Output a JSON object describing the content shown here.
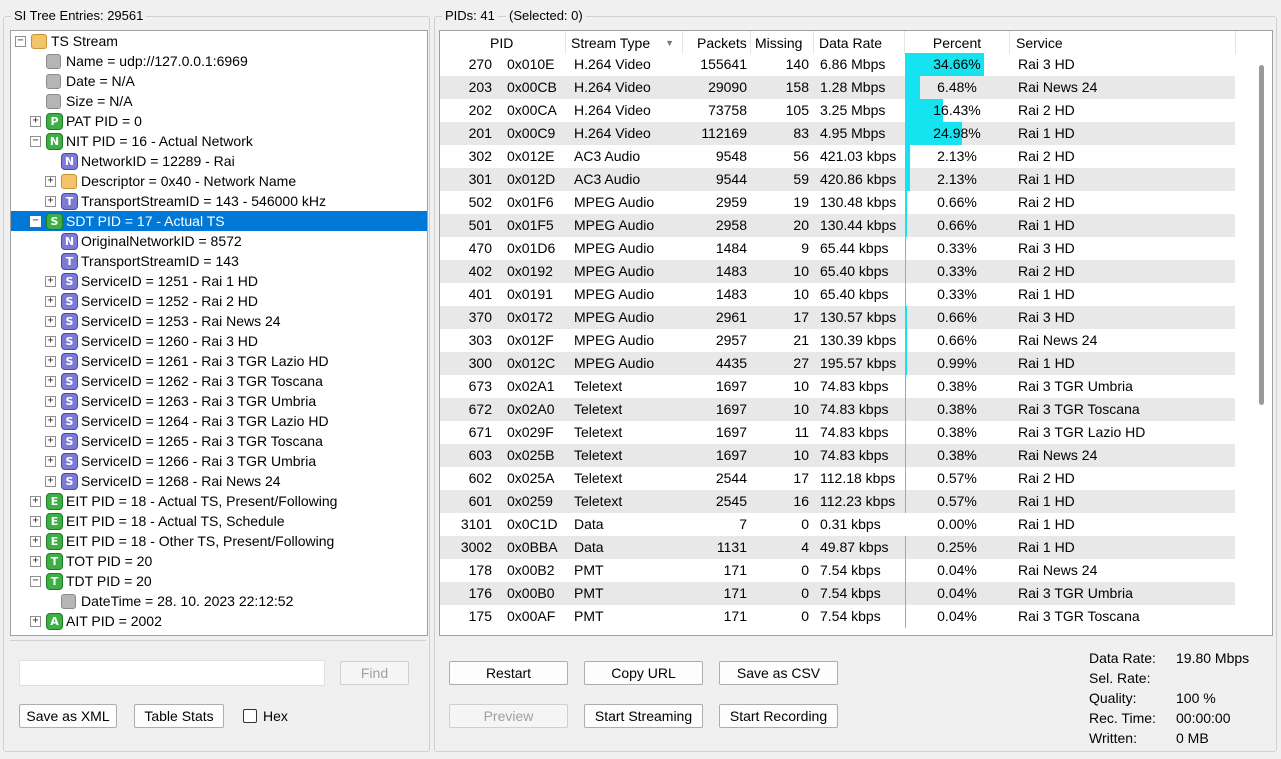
{
  "left_panel": {
    "title": "SI Tree Entries: 29561",
    "find_placeholder": "",
    "find_label": "Find",
    "save_xml_label": "Save as XML",
    "table_stats_label": "Table Stats",
    "hex_label": "Hex"
  },
  "tree": [
    {
      "depth": 0,
      "exp": "-",
      "icon": "folder",
      "letter": "",
      "label": "TS Stream"
    },
    {
      "depth": 1,
      "exp": "",
      "icon": "gray",
      "letter": "",
      "label": "Name = udp://127.0.0.1:6969"
    },
    {
      "depth": 1,
      "exp": "",
      "icon": "gray",
      "letter": "",
      "label": "Date = N/A"
    },
    {
      "depth": 1,
      "exp": "",
      "icon": "gray",
      "letter": "",
      "label": "Size = N/A"
    },
    {
      "depth": 1,
      "exp": "+",
      "icon": "green",
      "letter": "P",
      "label": "PAT PID = 0"
    },
    {
      "depth": 1,
      "exp": "-",
      "icon": "green",
      "letter": "N",
      "label": "NIT PID = 16 - Actual Network"
    },
    {
      "depth": 2,
      "exp": "",
      "icon": "purple",
      "letter": "N",
      "label": "NetworkID = 12289 - Rai"
    },
    {
      "depth": 2,
      "exp": "+",
      "icon": "folder",
      "letter": "",
      "label": "Descriptor = 0x40 - Network Name"
    },
    {
      "depth": 2,
      "exp": "+",
      "icon": "purple",
      "letter": "T",
      "label": "TransportStreamID = 143 - 546000 kHz"
    },
    {
      "depth": 1,
      "exp": "-",
      "icon": "green",
      "letter": "S",
      "label": "SDT PID = 17 - Actual TS",
      "selected": true
    },
    {
      "depth": 2,
      "exp": "",
      "icon": "purple",
      "letter": "N",
      "label": "OriginalNetworkID = 8572"
    },
    {
      "depth": 2,
      "exp": "",
      "icon": "purple",
      "letter": "T",
      "label": "TransportStreamID = 143"
    },
    {
      "depth": 2,
      "exp": "+",
      "icon": "purple",
      "letter": "S",
      "label": "ServiceID = 1251 - Rai 1 HD"
    },
    {
      "depth": 2,
      "exp": "+",
      "icon": "purple",
      "letter": "S",
      "label": "ServiceID = 1252 - Rai 2 HD"
    },
    {
      "depth": 2,
      "exp": "+",
      "icon": "purple",
      "letter": "S",
      "label": "ServiceID = 1253 - Rai News 24"
    },
    {
      "depth": 2,
      "exp": "+",
      "icon": "purple",
      "letter": "S",
      "label": "ServiceID = 1260 - Rai 3 HD"
    },
    {
      "depth": 2,
      "exp": "+",
      "icon": "purple",
      "letter": "S",
      "label": "ServiceID = 1261 - Rai 3 TGR Lazio HD"
    },
    {
      "depth": 2,
      "exp": "+",
      "icon": "purple",
      "letter": "S",
      "label": "ServiceID = 1262 - Rai 3 TGR Toscana"
    },
    {
      "depth": 2,
      "exp": "+",
      "icon": "purple",
      "letter": "S",
      "label": "ServiceID = 1263 - Rai 3 TGR Umbria"
    },
    {
      "depth": 2,
      "exp": "+",
      "icon": "purple",
      "letter": "S",
      "label": "ServiceID = 1264 - Rai 3 TGR Lazio HD"
    },
    {
      "depth": 2,
      "exp": "+",
      "icon": "purple",
      "letter": "S",
      "label": "ServiceID = 1265 - Rai 3 TGR Toscana"
    },
    {
      "depth": 2,
      "exp": "+",
      "icon": "purple",
      "letter": "S",
      "label": "ServiceID = 1266 - Rai 3 TGR Umbria"
    },
    {
      "depth": 2,
      "exp": "+",
      "icon": "purple",
      "letter": "S",
      "label": "ServiceID = 1268 - Rai News 24"
    },
    {
      "depth": 1,
      "exp": "+",
      "icon": "green",
      "letter": "E",
      "label": "EIT PID = 18 - Actual TS, Present/Following"
    },
    {
      "depth": 1,
      "exp": "+",
      "icon": "green",
      "letter": "E",
      "label": "EIT PID = 18 - Actual TS, Schedule"
    },
    {
      "depth": 1,
      "exp": "+",
      "icon": "green",
      "letter": "E",
      "label": "EIT PID = 18 - Other TS, Present/Following"
    },
    {
      "depth": 1,
      "exp": "+",
      "icon": "green",
      "letter": "T",
      "label": "TOT PID = 20"
    },
    {
      "depth": 1,
      "exp": "-",
      "icon": "green",
      "letter": "T",
      "label": "TDT PID = 20"
    },
    {
      "depth": 2,
      "exp": "",
      "icon": "gray",
      "letter": "",
      "label": "DateTime = 28. 10. 2023 22:12:52"
    },
    {
      "depth": 1,
      "exp": "+",
      "icon": "green",
      "letter": "A",
      "label": "AIT PID = 2002"
    }
  ],
  "right_panel": {
    "title": "PIDs: 41",
    "selected": "(Selected: 0)"
  },
  "columns": [
    "PID",
    "Stream Type",
    "Packets",
    "Missing",
    "Data Rate",
    "Percent",
    "Service"
  ],
  "rows": [
    {
      "pid": "270",
      "hex": "0x010E",
      "type": "H.264 Video",
      "packets": "155641",
      "missing": "140",
      "rate": "6.86 Mbps",
      "pct": "34.66%",
      "frac": 0.3466,
      "service": "Rai 3 HD"
    },
    {
      "pid": "203",
      "hex": "0x00CB",
      "type": "H.264 Video",
      "packets": "29090",
      "missing": "158",
      "rate": "1.28 Mbps",
      "pct": "6.48%",
      "frac": 0.0648,
      "service": "Rai News 24"
    },
    {
      "pid": "202",
      "hex": "0x00CA",
      "type": "H.264 Video",
      "packets": "73758",
      "missing": "105",
      "rate": "3.25 Mbps",
      "pct": "16.43%",
      "frac": 0.1643,
      "service": "Rai 2 HD"
    },
    {
      "pid": "201",
      "hex": "0x00C9",
      "type": "H.264 Video",
      "packets": "112169",
      "missing": "83",
      "rate": "4.95 Mbps",
      "pct": "24.98%",
      "frac": 0.2498,
      "service": "Rai 1 HD"
    },
    {
      "pid": "302",
      "hex": "0x012E",
      "type": "AC3 Audio",
      "packets": "9548",
      "missing": "56",
      "rate": "421.03 kbps",
      "pct": "2.13%",
      "frac": 0.0213,
      "service": "Rai 2 HD"
    },
    {
      "pid": "301",
      "hex": "0x012D",
      "type": "AC3 Audio",
      "packets": "9544",
      "missing": "59",
      "rate": "420.86 kbps",
      "pct": "2.13%",
      "frac": 0.0213,
      "service": "Rai 1 HD"
    },
    {
      "pid": "502",
      "hex": "0x01F6",
      "type": "MPEG Audio",
      "packets": "2959",
      "missing": "19",
      "rate": "130.48 kbps",
      "pct": "0.66%",
      "frac": 0.0066,
      "service": "Rai 2 HD"
    },
    {
      "pid": "501",
      "hex": "0x01F5",
      "type": "MPEG Audio",
      "packets": "2958",
      "missing": "20",
      "rate": "130.44 kbps",
      "pct": "0.66%",
      "frac": 0.0066,
      "service": "Rai 1 HD"
    },
    {
      "pid": "470",
      "hex": "0x01D6",
      "type": "MPEG Audio",
      "packets": "1484",
      "missing": "9",
      "rate": "65.44 kbps",
      "pct": "0.33%",
      "frac": 0.0033,
      "service": "Rai 3 HD"
    },
    {
      "pid": "402",
      "hex": "0x0192",
      "type": "MPEG Audio",
      "packets": "1483",
      "missing": "10",
      "rate": "65.40 kbps",
      "pct": "0.33%",
      "frac": 0.0033,
      "service": "Rai 2 HD"
    },
    {
      "pid": "401",
      "hex": "0x0191",
      "type": "MPEG Audio",
      "packets": "1483",
      "missing": "10",
      "rate": "65.40 kbps",
      "pct": "0.33%",
      "frac": 0.0033,
      "service": "Rai 1 HD"
    },
    {
      "pid": "370",
      "hex": "0x0172",
      "type": "MPEG Audio",
      "packets": "2961",
      "missing": "17",
      "rate": "130.57 kbps",
      "pct": "0.66%",
      "frac": 0.0066,
      "service": "Rai 3 HD"
    },
    {
      "pid": "303",
      "hex": "0x012F",
      "type": "MPEG Audio",
      "packets": "2957",
      "missing": "21",
      "rate": "130.39 kbps",
      "pct": "0.66%",
      "frac": 0.0066,
      "service": "Rai News 24"
    },
    {
      "pid": "300",
      "hex": "0x012C",
      "type": "MPEG Audio",
      "packets": "4435",
      "missing": "27",
      "rate": "195.57 kbps",
      "pct": "0.99%",
      "frac": 0.0099,
      "service": "Rai 1 HD"
    },
    {
      "pid": "673",
      "hex": "0x02A1",
      "type": "Teletext",
      "packets": "1697",
      "missing": "10",
      "rate": "74.83 kbps",
      "pct": "0.38%",
      "frac": 0.0038,
      "service": "Rai 3 TGR Umbria"
    },
    {
      "pid": "672",
      "hex": "0x02A0",
      "type": "Teletext",
      "packets": "1697",
      "missing": "10",
      "rate": "74.83 kbps",
      "pct": "0.38%",
      "frac": 0.0038,
      "service": "Rai 3 TGR Toscana"
    },
    {
      "pid": "671",
      "hex": "0x029F",
      "type": "Teletext",
      "packets": "1697",
      "missing": "11",
      "rate": "74.83 kbps",
      "pct": "0.38%",
      "frac": 0.0038,
      "service": "Rai 3 TGR Lazio HD"
    },
    {
      "pid": "603",
      "hex": "0x025B",
      "type": "Teletext",
      "packets": "1697",
      "missing": "10",
      "rate": "74.83 kbps",
      "pct": "0.38%",
      "frac": 0.0038,
      "service": "Rai News 24"
    },
    {
      "pid": "602",
      "hex": "0x025A",
      "type": "Teletext",
      "packets": "2544",
      "missing": "17",
      "rate": "112.18 kbps",
      "pct": "0.57%",
      "frac": 0.0057,
      "service": "Rai 2 HD"
    },
    {
      "pid": "601",
      "hex": "0x0259",
      "type": "Teletext",
      "packets": "2545",
      "missing": "16",
      "rate": "112.23 kbps",
      "pct": "0.57%",
      "frac": 0.0057,
      "service": "Rai 1 HD"
    },
    {
      "pid": "3101",
      "hex": "0x0C1D",
      "type": "Data",
      "packets": "7",
      "missing": "0",
      "rate": "0.31 kbps",
      "pct": "0.00%",
      "frac": 0.0,
      "service": "Rai 1 HD"
    },
    {
      "pid": "3002",
      "hex": "0x0BBA",
      "type": "Data",
      "packets": "1131",
      "missing": "4",
      "rate": "49.87 kbps",
      "pct": "0.25%",
      "frac": 0.0025,
      "service": "Rai 1 HD"
    },
    {
      "pid": "178",
      "hex": "0x00B2",
      "type": "PMT",
      "packets": "171",
      "missing": "0",
      "rate": "7.54 kbps",
      "pct": "0.04%",
      "frac": 0.0004,
      "service": "Rai News 24"
    },
    {
      "pid": "176",
      "hex": "0x00B0",
      "type": "PMT",
      "packets": "171",
      "missing": "0",
      "rate": "7.54 kbps",
      "pct": "0.04%",
      "frac": 0.0004,
      "service": "Rai 3 TGR Umbria"
    },
    {
      "pid": "175",
      "hex": "0x00AF",
      "type": "PMT",
      "packets": "171",
      "missing": "0",
      "rate": "7.54 kbps",
      "pct": "0.04%",
      "frac": 0.0004,
      "service": "Rai 3 TGR Toscana"
    }
  ],
  "buttons": {
    "restart": "Restart",
    "copy_url": "Copy URL",
    "save_csv": "Save as CSV",
    "preview": "Preview",
    "start_streaming": "Start Streaming",
    "start_recording": "Start Recording"
  },
  "stats": [
    {
      "label": "Data Rate:",
      "value": "19.80 Mbps"
    },
    {
      "label": "Sel. Rate:",
      "value": ""
    },
    {
      "label": "Quality:",
      "value": "100 %"
    },
    {
      "label": "Rec. Time:",
      "value": "00:00:00"
    },
    {
      "label": "Written:",
      "value": "0 MB"
    }
  ],
  "colors": {
    "selection": "#0078d7",
    "bar": "#15e4f0",
    "alt_row": "#e8e8e8"
  }
}
